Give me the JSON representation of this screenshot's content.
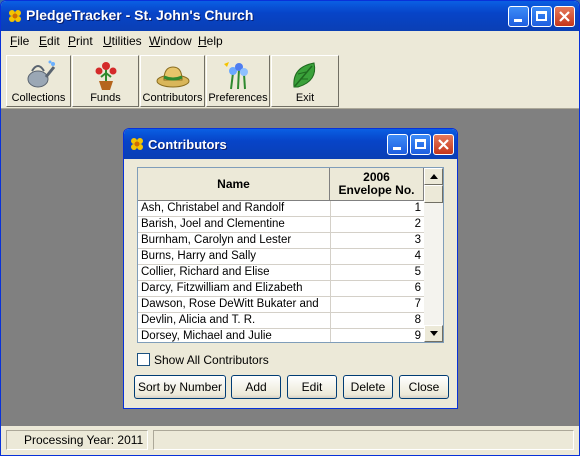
{
  "app": {
    "title": "PledgeTracker - St. John's Church"
  },
  "menu": [
    {
      "label": "File",
      "key": "F",
      "rest": "ile"
    },
    {
      "label": "Edit",
      "key": "E",
      "rest": "dit"
    },
    {
      "label": "Print",
      "key": "P",
      "rest": "rint"
    },
    {
      "label": "Utilities",
      "key": "U",
      "rest": "tilities"
    },
    {
      "label": "Window",
      "key": "W",
      "rest": "indow"
    },
    {
      "label": "Help",
      "key": "H",
      "rest": "elp"
    }
  ],
  "toolbar": [
    {
      "label": "Collections",
      "icon": "watering-can-icon"
    },
    {
      "label": "Funds",
      "icon": "flower-pot-icon"
    },
    {
      "label": "Contributors",
      "icon": "straw-hat-icon"
    },
    {
      "label": "Preferences",
      "icon": "flowers-icon"
    },
    {
      "label": "Exit",
      "icon": "leaf-icon"
    }
  ],
  "dialog": {
    "title": "Contributors",
    "columns": {
      "name": "Name",
      "envelope_line1": "2006",
      "envelope_line2": "Envelope No."
    },
    "rows": [
      {
        "name": "Ash, Christabel and Randolf",
        "envelope": "1"
      },
      {
        "name": "Barish, Joel and Clementine",
        "envelope": "2"
      },
      {
        "name": "Burnham, Carolyn and Lester",
        "envelope": "3"
      },
      {
        "name": "Burns, Harry and Sally",
        "envelope": "4"
      },
      {
        "name": "Collier, Richard and Elise",
        "envelope": "5"
      },
      {
        "name": "Darcy, Fitzwilliam and Elizabeth",
        "envelope": "6"
      },
      {
        "name": "Dawson, Rose DeWitt Bukater and",
        "envelope": "7"
      },
      {
        "name": "Devlin, Alicia and T. R.",
        "envelope": "8"
      },
      {
        "name": "Dorsey, Michael and Julie",
        "envelope": "9"
      }
    ],
    "show_all_label": "Show All Contributors",
    "show_all_checked": false,
    "buttons": {
      "sort": "Sort by Number",
      "add": "Add",
      "edit": "Edit",
      "delete": "Delete",
      "close": "Close"
    }
  },
  "status": {
    "processing_year": "Processing Year: 2011"
  },
  "colors": {
    "titlebar": "#0a5fe3",
    "workspace": "#808080",
    "chrome": "#ece9d8"
  }
}
